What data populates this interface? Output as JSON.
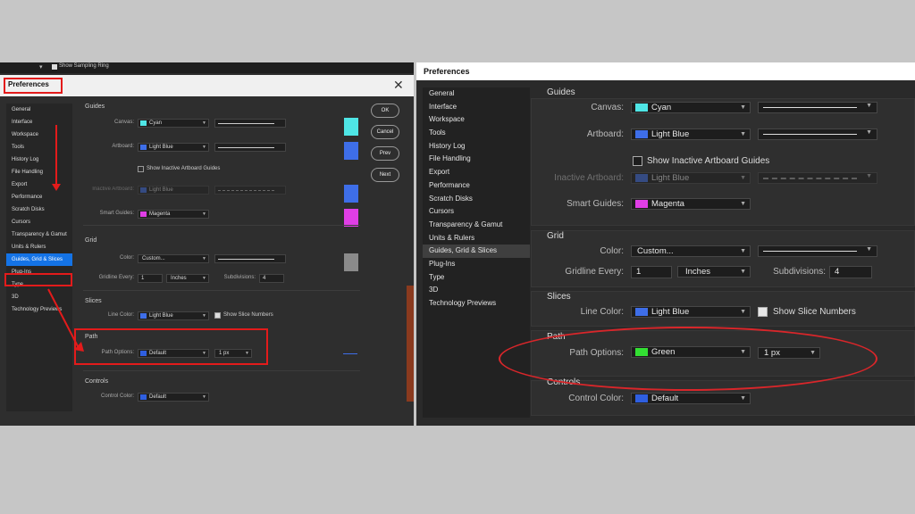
{
  "left": {
    "topstrip_label": "Show Sampling Ring",
    "title": "Preferences",
    "close_glyph": "✕",
    "nav": [
      "General",
      "Interface",
      "Workspace",
      "Tools",
      "History Log",
      "File Handling",
      "Export",
      "Performance",
      "Scratch Disks",
      "Cursors",
      "Transparency & Gamut",
      "Units & Rulers",
      "Guides, Grid & Slices",
      "Plug-Ins",
      "Type",
      "3D",
      "Technology Previews"
    ],
    "buttons": {
      "ok": "OK",
      "cancel": "Cancel",
      "prev": "Prev",
      "next": "Next"
    },
    "guides": {
      "section": "Guides",
      "canvas_label": "Canvas:",
      "canvas_value": "Cyan",
      "artboard_label": "Artboard:",
      "artboard_value": "Light Blue",
      "inactive_check": "Show Inactive Artboard Guides",
      "inactive_label": "Inactive Artboard:",
      "inactive_value": "Light Blue",
      "smart_label": "Smart Guides:",
      "smart_value": "Magenta"
    },
    "grid": {
      "section": "Grid",
      "color_label": "Color:",
      "color_value": "Custom...",
      "gridline_label": "Gridline Every:",
      "gridline_value": "1",
      "unit_value": "Inches",
      "subdiv_label": "Subdivisions:",
      "subdiv_value": "4"
    },
    "slices": {
      "section": "Slices",
      "line_label": "Line Color:",
      "line_value": "Light Blue",
      "show_numbers": "Show Slice Numbers"
    },
    "path": {
      "section": "Path",
      "options_label": "Path Options:",
      "options_value": "Default",
      "width_value": "1 px"
    },
    "controls": {
      "section": "Controls",
      "color_label": "Control Color:",
      "color_value": "Default"
    }
  },
  "right": {
    "title": "Preferences",
    "nav": [
      "General",
      "Interface",
      "Workspace",
      "Tools",
      "History Log",
      "File Handling",
      "Export",
      "Performance",
      "Scratch Disks",
      "Cursors",
      "Transparency & Gamut",
      "Units & Rulers",
      "Guides, Grid & Slices",
      "Plug-Ins",
      "Type",
      "3D",
      "Technology Previews"
    ],
    "guides": {
      "section": "Guides",
      "canvas_label": "Canvas:",
      "canvas_value": "Cyan",
      "artboard_label": "Artboard:",
      "artboard_value": "Light Blue",
      "inactive_check": "Show Inactive Artboard Guides",
      "inactive_label": "Inactive Artboard:",
      "inactive_value": "Light Blue",
      "smart_label": "Smart Guides:",
      "smart_value": "Magenta"
    },
    "grid": {
      "section": "Grid",
      "color_label": "Color:",
      "color_value": "Custom...",
      "gridline_label": "Gridline Every:",
      "gridline_value": "1",
      "unit_value": "Inches",
      "subdiv_label": "Subdivisions:",
      "subdiv_value": "4"
    },
    "slices": {
      "section": "Slices",
      "line_label": "Line Color:",
      "line_value": "Light Blue",
      "show_numbers": "Show Slice Numbers"
    },
    "path": {
      "section": "Path",
      "options_label": "Path Options:",
      "options_value": "Green",
      "width_value": "1 px"
    },
    "controls": {
      "section": "Controls",
      "color_label": "Control Color:",
      "color_value": "Default"
    }
  },
  "colors": {
    "cyan": "#4fe6e6",
    "lightblue": "#3e6ee8",
    "magenta": "#e03ee6",
    "green": "#33e033",
    "blue": "#2f5fe0",
    "gray": "#8a8a8a",
    "highlight_red": "#e31b1b"
  },
  "icons": {
    "chevron": "chevron-down-icon",
    "close": "close-icon",
    "check": "checkbox-icon"
  }
}
